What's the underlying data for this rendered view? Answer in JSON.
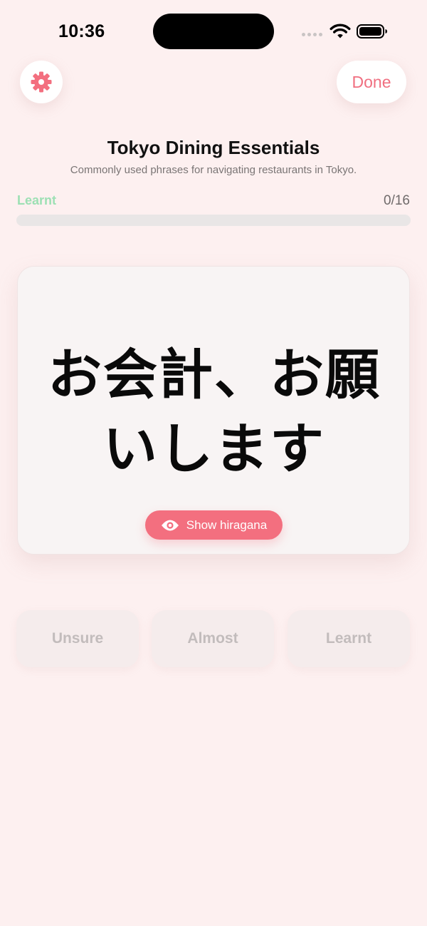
{
  "status_bar": {
    "time": "10:36"
  },
  "header": {
    "settings_icon": "gear-icon",
    "done_label": "Done",
    "title": "Tokyo Dining Essentials",
    "subtitle": "Commonly used phrases for navigating restaurants in Tokyo."
  },
  "progress": {
    "label": "Learnt",
    "count_text": "0/16",
    "learnt": 0,
    "total": 16,
    "fraction": 0
  },
  "card": {
    "phrase": "お会計、お願いします",
    "show_button_icon": "eye-icon",
    "show_button_label": "Show hiragana"
  },
  "rating": {
    "unsure": "Unsure",
    "almost": "Almost",
    "learnt": "Learnt"
  },
  "colors": {
    "background": "#fdf0f0",
    "accent": "#f36f7f",
    "learnt_green": "#9de0b4",
    "disabled_text": "#c2bcbc"
  }
}
